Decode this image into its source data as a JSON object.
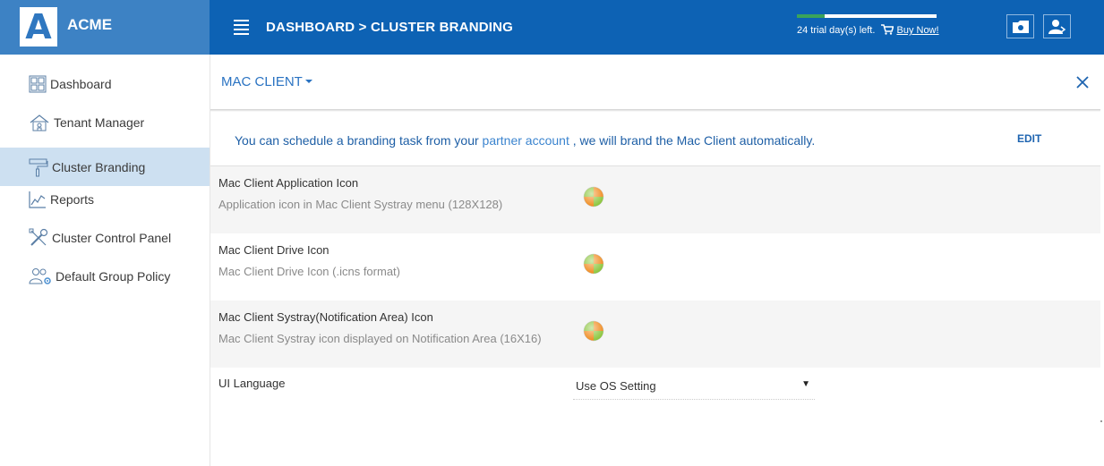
{
  "app": {
    "logo_letter": "A",
    "name": "ACME"
  },
  "header": {
    "breadcrumb": "DASHBOARD > CLUSTER BRANDING",
    "trial_text": "24 trial day(s) left.",
    "buy_label": "Buy Now!",
    "trial_progress_fraction": 0.2,
    "icons": [
      "folder-icon",
      "user-account-icon"
    ]
  },
  "sidebar": {
    "items": [
      {
        "label": "Dashboard",
        "icon": "dashboard-grid-icon",
        "active": false
      },
      {
        "label": "Tenant Manager",
        "icon": "tenant-house-icon",
        "active": false
      },
      {
        "label": "Cluster Branding",
        "icon": "paint-roller-icon",
        "active": true
      },
      {
        "label": "Reports",
        "icon": "chart-icon",
        "active": false
      },
      {
        "label": "Cluster Control Panel",
        "icon": "tools-icon",
        "active": false
      },
      {
        "label": "Default Group Policy",
        "icon": "group-settings-icon",
        "active": false
      }
    ]
  },
  "main": {
    "client_selector": "MAC CLIENT",
    "notice": {
      "before": "You can schedule a branding task from your ",
      "link": "partner account",
      "after": " , we will brand the Mac Client automatically."
    },
    "edit_label": "EDIT",
    "rows": [
      {
        "title": "Mac Client Application Icon",
        "desc": "Application icon in Mac Client Systray menu (128X128)"
      },
      {
        "title": "Mac Client Drive Icon",
        "desc": "Mac Client Drive Icon (.icns format)"
      },
      {
        "title": "Mac Client Systray(Notification Area) Icon",
        "desc": "Mac Client Systray icon displayed on Notification Area (16X16)"
      }
    ],
    "language": {
      "label": "UI Language",
      "value": "Use OS Setting"
    }
  },
  "colors": {
    "topbar": "#0d62b4",
    "logo_bg": "#3d82c4",
    "active_nav": "#cde0f1",
    "accent_text": "#1e5fa6"
  }
}
